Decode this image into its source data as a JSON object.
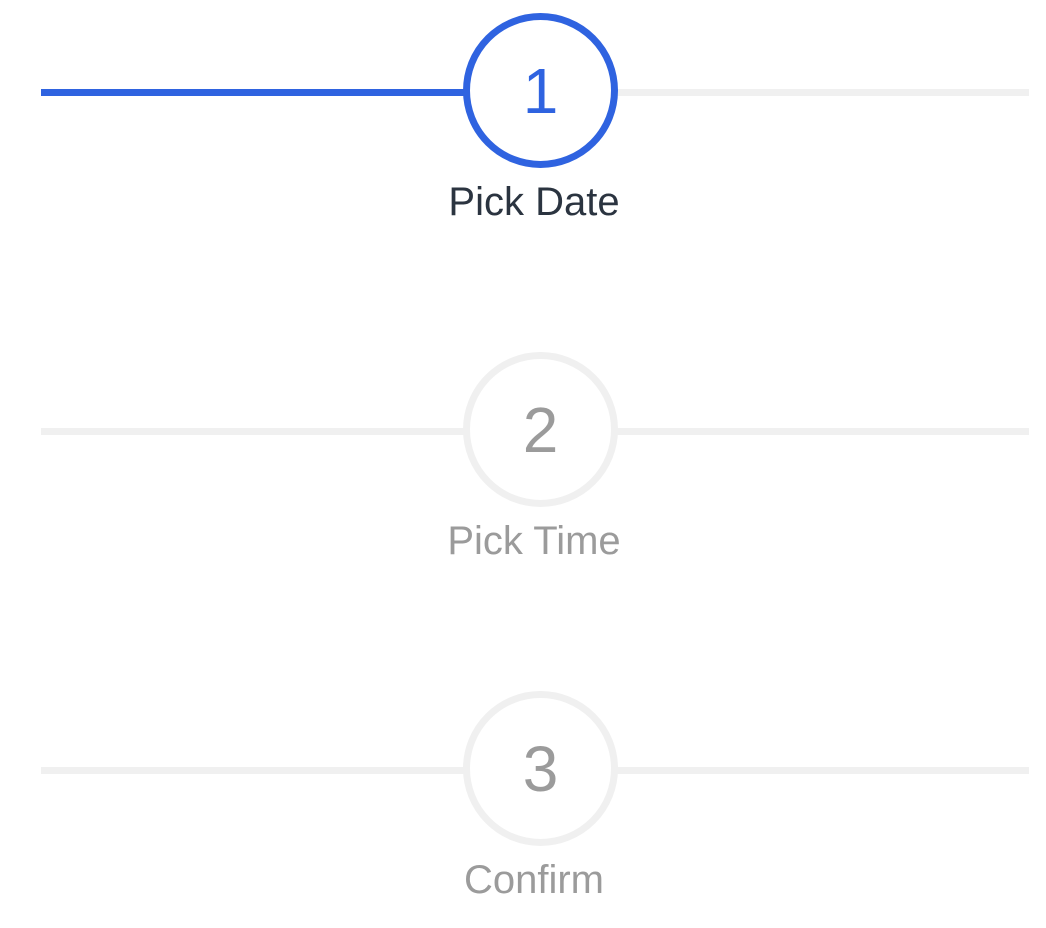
{
  "stepper": {
    "active_index": 0,
    "accent_color": "#2f63e0",
    "inactive_color": "#f0f0f0",
    "steps": [
      {
        "number": "1",
        "label": "Pick Date",
        "state": "active"
      },
      {
        "number": "2",
        "label": "Pick Time",
        "state": "inactive"
      },
      {
        "number": "3",
        "label": "Confirm",
        "state": "inactive"
      }
    ]
  }
}
